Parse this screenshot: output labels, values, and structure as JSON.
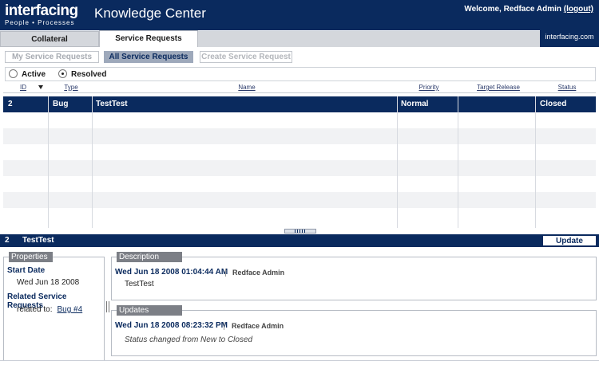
{
  "header": {
    "logo_main": "interfacing",
    "logo_tag": "People • Processes",
    "app_title": "Knowledge Center",
    "welcome_text": "Welcome, Redface Admin",
    "logout_label": "(logout)"
  },
  "top_tabs": {
    "collateral": "Collateral",
    "service_requests": "Service Requests",
    "site_link": "interfacing.com"
  },
  "sub_tabs": {
    "mine": "My Service Requests",
    "all": "All Service Requests",
    "create": "Create Service Request"
  },
  "filter": {
    "active_label": "Active",
    "resolved_label": "Resolved",
    "selected": "Resolved"
  },
  "grid": {
    "columns": [
      "ID",
      "Type",
      "Name",
      "Priority",
      "Target Release",
      "Status"
    ],
    "rows": [
      {
        "id": "2",
        "type": "Bug",
        "name": "TestTest",
        "priority": "Normal",
        "target_release": "",
        "status": "Closed"
      }
    ]
  },
  "detail": {
    "id": "2",
    "title": "TestTest",
    "update_label": "Update"
  },
  "properties": {
    "label": "Properties",
    "start_date_label": "Start Date",
    "start_date_value": "Wed Jun 18 2008",
    "related_label": "Related Service Requests",
    "related_prefix": "related to:",
    "related_link": "Bug #4"
  },
  "description": {
    "label": "Description",
    "date": "Wed Jun 18 2008 01:04:44 AM",
    "author": "Redface Admin",
    "body": "TestTest"
  },
  "updates": {
    "label": "Updates",
    "date": "Wed Jun 18 2008 08:23:32 PM",
    "author": "Redface Admin",
    "body": "Status changed from New to Closed"
  },
  "colors": {
    "navy": "#0a2a5e",
    "tab_gray": "#d4d7dc",
    "label_gray": "#7c7f86"
  }
}
